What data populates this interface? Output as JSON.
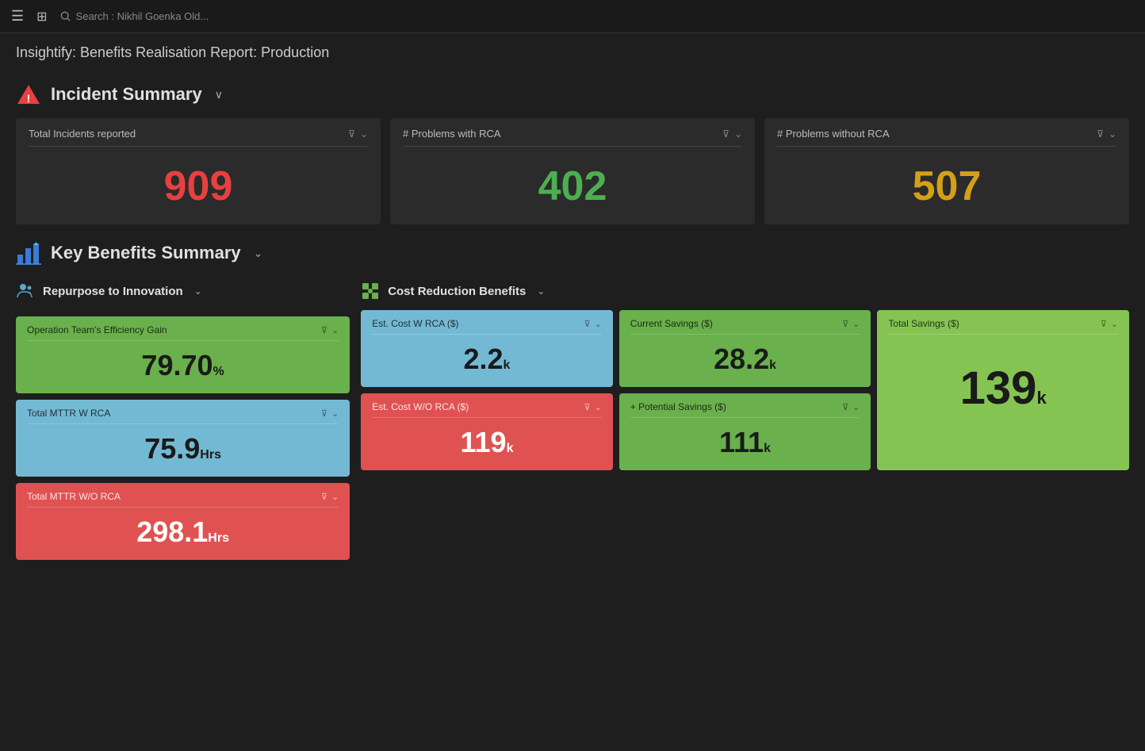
{
  "topbar": {
    "search_placeholder": "Search : Nikhil Goenka Old..."
  },
  "page_title": "Insightify: Benefits Realisation Report: Production",
  "incident_summary": {
    "section_title": "Incident Summary",
    "cards": [
      {
        "id": "total-incidents",
        "title": "Total Incidents reported",
        "value": "909",
        "color": "red",
        "unit": ""
      },
      {
        "id": "problems-with-rca",
        "title": "# Problems with RCA",
        "value": "402",
        "color": "green",
        "unit": ""
      },
      {
        "id": "problems-without-rca",
        "title": "# Problems without RCA",
        "value": "507",
        "color": "yellow",
        "unit": ""
      }
    ]
  },
  "key_benefits": {
    "section_title": "Key Benefits Summary",
    "repurpose": {
      "subtitle": "Repurpose to Innovation",
      "tiles": [
        {
          "id": "op-efficiency",
          "title": "Operation Team's Efficiency Gain",
          "value": "79.70",
          "unit": "%",
          "color": "green"
        },
        {
          "id": "total-mttr-rca",
          "title": "Total MTTR W RCA",
          "value": "75.9",
          "unit": "Hrs",
          "color": "light-blue"
        },
        {
          "id": "total-mttr-no-rca",
          "title": "Total MTTR W/O RCA",
          "value": "298.1",
          "unit": "Hrs",
          "color": "red"
        }
      ]
    },
    "cost_reduction": {
      "subtitle": "Cost Reduction Benefits",
      "tiles": [
        {
          "id": "est-cost-rca",
          "title": "Est. Cost W RCA ($)",
          "value": "2.2",
          "unit": "k",
          "color": "light-blue",
          "grid_col": 1,
          "grid_row": 1
        },
        {
          "id": "current-savings",
          "title": "Current Savings ($)",
          "value": "28.2",
          "unit": "k",
          "color": "green",
          "grid_col": 2,
          "grid_row": 1
        },
        {
          "id": "total-savings",
          "title": "Total Savings ($)",
          "value": "139",
          "unit": "k",
          "color": "green-light",
          "grid_col": 3,
          "grid_row": "span"
        },
        {
          "id": "est-cost-no-rca",
          "title": "Est. Cost W/O RCA ($)",
          "value": "119",
          "unit": "k",
          "color": "red",
          "grid_col": 1,
          "grid_row": 2
        },
        {
          "id": "potential-savings",
          "title": "+ Potential Savings ($)",
          "value": "111",
          "unit": "k",
          "color": "green",
          "grid_col": 2,
          "grid_row": 2
        }
      ]
    }
  },
  "icons": {
    "chevron_down": "∨",
    "filter": "⊽",
    "chevron_down_small": "⌄"
  }
}
